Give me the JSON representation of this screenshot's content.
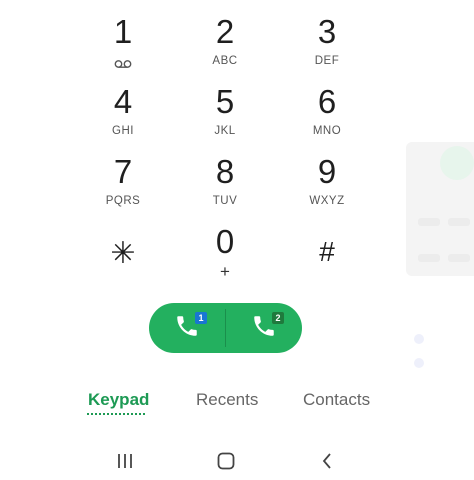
{
  "keypad": {
    "keys": [
      {
        "digit": "1",
        "letters": ""
      },
      {
        "digit": "2",
        "letters": "ABC"
      },
      {
        "digit": "3",
        "letters": "DEF"
      },
      {
        "digit": "4",
        "letters": "GHI"
      },
      {
        "digit": "5",
        "letters": "JKL"
      },
      {
        "digit": "6",
        "letters": "MNO"
      },
      {
        "digit": "7",
        "letters": "PQRS"
      },
      {
        "digit": "8",
        "letters": "TUV"
      },
      {
        "digit": "9",
        "letters": "WXYZ"
      },
      {
        "digit": "✳",
        "letters": ""
      },
      {
        "digit": "0",
        "letters": "+"
      },
      {
        "digit": "#",
        "letters": ""
      }
    ],
    "voicemail_icon": "voicemail-icon"
  },
  "call": {
    "sim1_badge": "1",
    "sim2_badge": "2",
    "icon": "phone-icon",
    "color": "#23b05f"
  },
  "tabs": {
    "keypad": "Keypad",
    "recents": "Recents",
    "contacts": "Contacts",
    "active_color": "#1d9a54"
  },
  "nav": {
    "recents_icon": "recent-apps-icon",
    "home_icon": "home-icon",
    "back_icon": "back-icon"
  }
}
